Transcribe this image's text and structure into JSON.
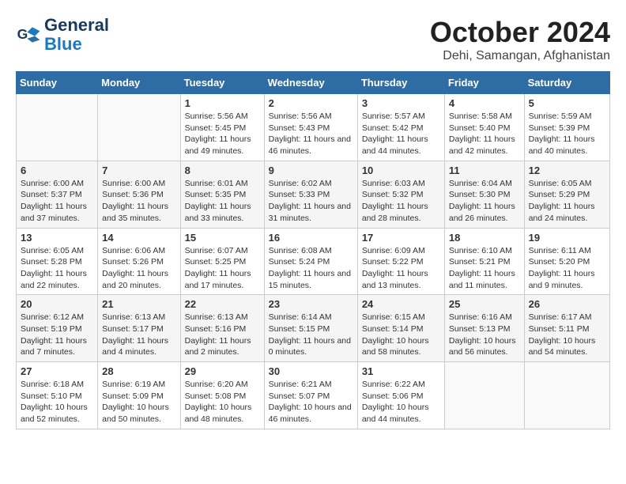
{
  "header": {
    "logo_line1": "General",
    "logo_line2": "Blue",
    "month": "October 2024",
    "location": "Dehi, Samangan, Afghanistan"
  },
  "weekdays": [
    "Sunday",
    "Monday",
    "Tuesday",
    "Wednesday",
    "Thursday",
    "Friday",
    "Saturday"
  ],
  "weeks": [
    [
      {
        "day": "",
        "info": ""
      },
      {
        "day": "",
        "info": ""
      },
      {
        "day": "1",
        "info": "Sunrise: 5:56 AM\nSunset: 5:45 PM\nDaylight: 11 hours and 49 minutes."
      },
      {
        "day": "2",
        "info": "Sunrise: 5:56 AM\nSunset: 5:43 PM\nDaylight: 11 hours and 46 minutes."
      },
      {
        "day": "3",
        "info": "Sunrise: 5:57 AM\nSunset: 5:42 PM\nDaylight: 11 hours and 44 minutes."
      },
      {
        "day": "4",
        "info": "Sunrise: 5:58 AM\nSunset: 5:40 PM\nDaylight: 11 hours and 42 minutes."
      },
      {
        "day": "5",
        "info": "Sunrise: 5:59 AM\nSunset: 5:39 PM\nDaylight: 11 hours and 40 minutes."
      }
    ],
    [
      {
        "day": "6",
        "info": "Sunrise: 6:00 AM\nSunset: 5:37 PM\nDaylight: 11 hours and 37 minutes."
      },
      {
        "day": "7",
        "info": "Sunrise: 6:00 AM\nSunset: 5:36 PM\nDaylight: 11 hours and 35 minutes."
      },
      {
        "day": "8",
        "info": "Sunrise: 6:01 AM\nSunset: 5:35 PM\nDaylight: 11 hours and 33 minutes."
      },
      {
        "day": "9",
        "info": "Sunrise: 6:02 AM\nSunset: 5:33 PM\nDaylight: 11 hours and 31 minutes."
      },
      {
        "day": "10",
        "info": "Sunrise: 6:03 AM\nSunset: 5:32 PM\nDaylight: 11 hours and 28 minutes."
      },
      {
        "day": "11",
        "info": "Sunrise: 6:04 AM\nSunset: 5:30 PM\nDaylight: 11 hours and 26 minutes."
      },
      {
        "day": "12",
        "info": "Sunrise: 6:05 AM\nSunset: 5:29 PM\nDaylight: 11 hours and 24 minutes."
      }
    ],
    [
      {
        "day": "13",
        "info": "Sunrise: 6:05 AM\nSunset: 5:28 PM\nDaylight: 11 hours and 22 minutes."
      },
      {
        "day": "14",
        "info": "Sunrise: 6:06 AM\nSunset: 5:26 PM\nDaylight: 11 hours and 20 minutes."
      },
      {
        "day": "15",
        "info": "Sunrise: 6:07 AM\nSunset: 5:25 PM\nDaylight: 11 hours and 17 minutes."
      },
      {
        "day": "16",
        "info": "Sunrise: 6:08 AM\nSunset: 5:24 PM\nDaylight: 11 hours and 15 minutes."
      },
      {
        "day": "17",
        "info": "Sunrise: 6:09 AM\nSunset: 5:22 PM\nDaylight: 11 hours and 13 minutes."
      },
      {
        "day": "18",
        "info": "Sunrise: 6:10 AM\nSunset: 5:21 PM\nDaylight: 11 hours and 11 minutes."
      },
      {
        "day": "19",
        "info": "Sunrise: 6:11 AM\nSunset: 5:20 PM\nDaylight: 11 hours and 9 minutes."
      }
    ],
    [
      {
        "day": "20",
        "info": "Sunrise: 6:12 AM\nSunset: 5:19 PM\nDaylight: 11 hours and 7 minutes."
      },
      {
        "day": "21",
        "info": "Sunrise: 6:13 AM\nSunset: 5:17 PM\nDaylight: 11 hours and 4 minutes."
      },
      {
        "day": "22",
        "info": "Sunrise: 6:13 AM\nSunset: 5:16 PM\nDaylight: 11 hours and 2 minutes."
      },
      {
        "day": "23",
        "info": "Sunrise: 6:14 AM\nSunset: 5:15 PM\nDaylight: 11 hours and 0 minutes."
      },
      {
        "day": "24",
        "info": "Sunrise: 6:15 AM\nSunset: 5:14 PM\nDaylight: 10 hours and 58 minutes."
      },
      {
        "day": "25",
        "info": "Sunrise: 6:16 AM\nSunset: 5:13 PM\nDaylight: 10 hours and 56 minutes."
      },
      {
        "day": "26",
        "info": "Sunrise: 6:17 AM\nSunset: 5:11 PM\nDaylight: 10 hours and 54 minutes."
      }
    ],
    [
      {
        "day": "27",
        "info": "Sunrise: 6:18 AM\nSunset: 5:10 PM\nDaylight: 10 hours and 52 minutes."
      },
      {
        "day": "28",
        "info": "Sunrise: 6:19 AM\nSunset: 5:09 PM\nDaylight: 10 hours and 50 minutes."
      },
      {
        "day": "29",
        "info": "Sunrise: 6:20 AM\nSunset: 5:08 PM\nDaylight: 10 hours and 48 minutes."
      },
      {
        "day": "30",
        "info": "Sunrise: 6:21 AM\nSunset: 5:07 PM\nDaylight: 10 hours and 46 minutes."
      },
      {
        "day": "31",
        "info": "Sunrise: 6:22 AM\nSunset: 5:06 PM\nDaylight: 10 hours and 44 minutes."
      },
      {
        "day": "",
        "info": ""
      },
      {
        "day": "",
        "info": ""
      }
    ]
  ]
}
